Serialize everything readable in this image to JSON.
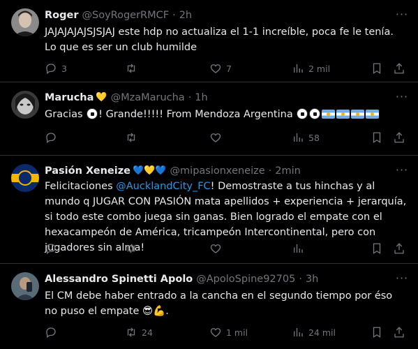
{
  "tweets": [
    {
      "name": "Roger",
      "emoji": "",
      "handle": "@SoyRogerRMCF",
      "time": "2h",
      "text": "JAJAJAJAJSJSJAJ este hdp no actualiza el 1-1 increíble, poca fe le tenía. Lo que es ser un club humilde",
      "replies": "3",
      "retweets": "",
      "likes": "7",
      "views": "2 mil"
    },
    {
      "name": "Marucha",
      "emoji": "💛",
      "handle": "@MzaMarucha",
      "time": "1h",
      "text_parts": [
        "Gracias ",
        "! Grande!!!!! From Mendoza  Argentina "
      ],
      "replies": "",
      "retweets": "",
      "likes": "",
      "views": "58"
    },
    {
      "name": "Pasión Xeneize",
      "emoji": "💙💛💙",
      "handle": "@mipasionxeneize",
      "time": "2min",
      "text_before": "Felicitaciones ",
      "mention": "@AucklandCity_FC",
      "text_after": "! Demostraste a tus hinchas y al mundo q JUGAR CON PASIÓN mata apellidos + experiencia + jerarquía, si todo este combo juega sin ganas. Bien logrado el empate con el hexacampeón de América, tricampeón Intercontinental, pero con jugadores sin alma!",
      "replies": "",
      "retweets": "",
      "likes": "",
      "views": ""
    },
    {
      "name": "Alessandro Spinetti Apolo",
      "emoji": "",
      "handle": "@ApoloSpine92705",
      "time": "3h",
      "text": "El CM debe haber entrado a la cancha en el segundo tiempo por éso no puso el empate ",
      "text_emoji": "😎💪",
      "text_end": ".",
      "replies": "",
      "retweets": "24",
      "likes": "1 mil",
      "views": "24 mil"
    }
  ],
  "separator": "·",
  "more_icon": "more-dots-icon",
  "colors": {
    "background": "#000000",
    "text": "#e7e9ea",
    "muted": "#71767b",
    "link": "#1d9bf0",
    "border": "#2f3336"
  }
}
